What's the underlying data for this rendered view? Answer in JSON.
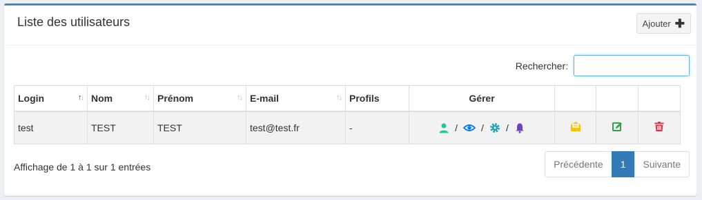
{
  "header": {
    "title": "Liste des utilisateurs",
    "add_label": "Ajouter"
  },
  "search": {
    "label": "Rechercher:",
    "value": ""
  },
  "table": {
    "columns": [
      "Login",
      "Nom",
      "Prénom",
      "E-mail",
      "Profils",
      "Gérer"
    ],
    "rows": [
      {
        "login": "test",
        "nom": "TEST",
        "prenom": "TEST",
        "email": "test@test.fr",
        "profils": "-"
      }
    ],
    "manage_icons": [
      "user-icon",
      "eye-icon",
      "gear-icon",
      "bell-icon"
    ],
    "action_icons": [
      "mail-icon",
      "edit-icon",
      "trash-icon"
    ]
  },
  "footer": {
    "info": "Affichage de 1 à 1 sur 1 entrées",
    "prev_label": "Précédente",
    "page": "1",
    "next_label": "Suivante"
  },
  "colors": {
    "accent": "#3c8dbc",
    "user": "#20c997",
    "eye": "#007bff",
    "gear": "#17a2b8",
    "bell": "#6f42c1",
    "mail": "#ffc107",
    "edit": "#28a745",
    "trash": "#dc3545",
    "pager_active": "#337ab7"
  }
}
